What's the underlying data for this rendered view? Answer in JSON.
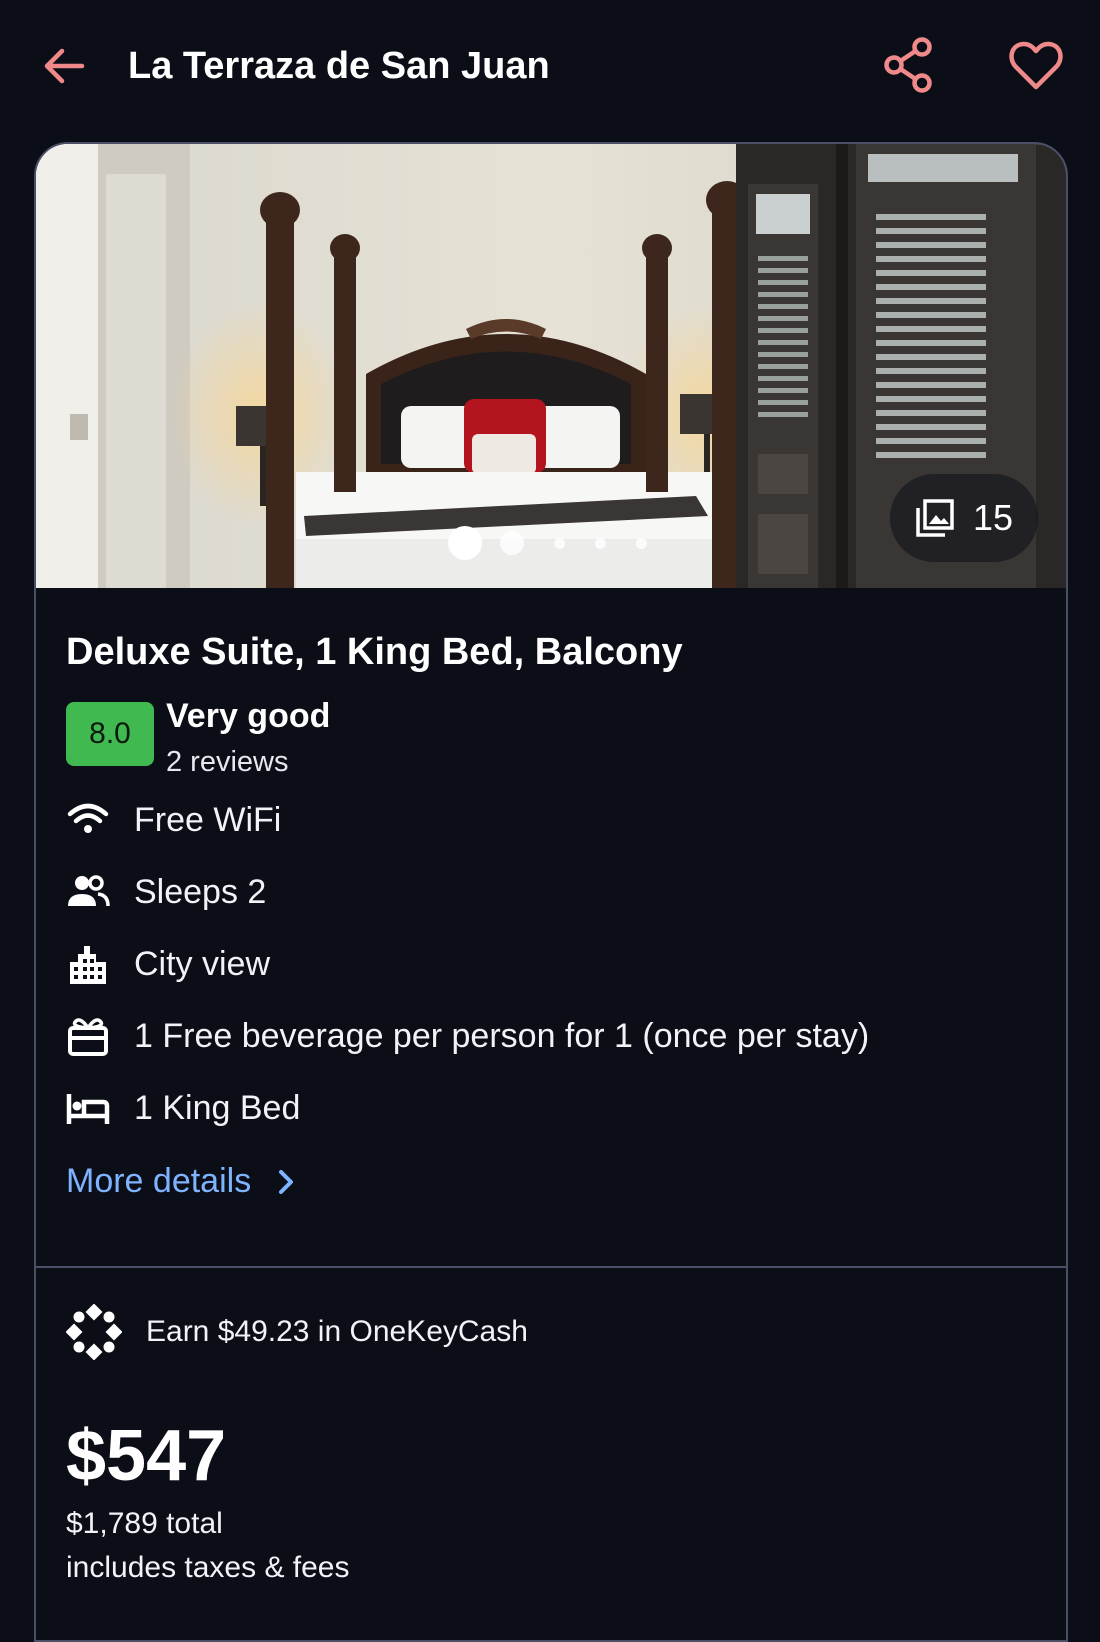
{
  "header": {
    "title": "La Terraza de San Juan",
    "back_icon": "arrow-left-icon",
    "share_icon": "share-icon",
    "favorite_icon": "heart-outline-icon",
    "accent_color": "#f08a8a"
  },
  "gallery": {
    "photo_count": "15",
    "photo_icon": "photo-library-icon",
    "total_dots": 5,
    "active_dot": 1
  },
  "room": {
    "title": "Deluxe Suite, 1 King Bed, Balcony",
    "rating": {
      "score": "8.0",
      "label": "Very good",
      "reviews": "2 reviews",
      "badge_color": "#3fb950"
    },
    "amenities": [
      {
        "icon": "wifi-icon",
        "text": "Free WiFi"
      },
      {
        "icon": "people-icon",
        "text": "Sleeps 2"
      },
      {
        "icon": "city-icon",
        "text": "City view"
      },
      {
        "icon": "gift-icon",
        "text": "1 Free beverage per person for 1 (once per stay)"
      },
      {
        "icon": "bed-icon",
        "text": "1 King Bed"
      }
    ],
    "more_details_label": "More details",
    "link_color": "#7eb4ff"
  },
  "rewards": {
    "icon": "onekeycash-icon",
    "text": "Earn $49.23 in OneKeyCash"
  },
  "pricing": {
    "nightly": "$547",
    "total": "$1,789 total",
    "taxes_note": "includes taxes & fees"
  }
}
